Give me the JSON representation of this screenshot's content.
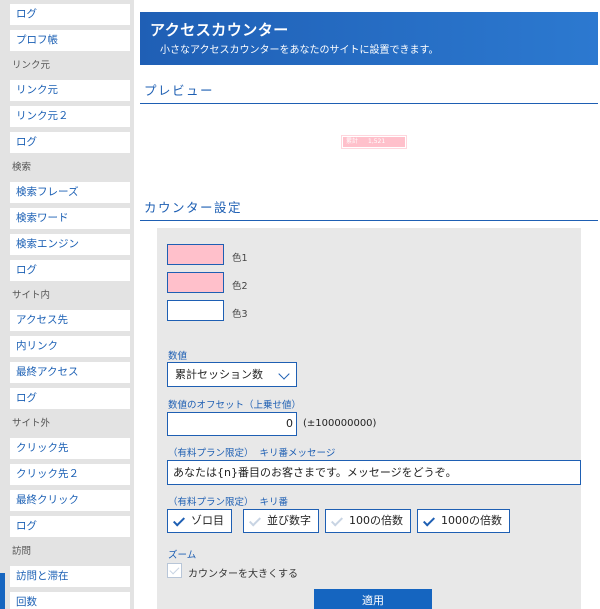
{
  "sidebar": {
    "entries": [
      {
        "kind": "item",
        "label": "ログ"
      },
      {
        "kind": "item",
        "label": "プロフ帳"
      },
      {
        "kind": "head",
        "label": "リンク元"
      },
      {
        "kind": "item",
        "label": "リンク元"
      },
      {
        "kind": "item",
        "label": "リンク元２"
      },
      {
        "kind": "item",
        "label": "ログ"
      },
      {
        "kind": "head",
        "label": "検索"
      },
      {
        "kind": "item",
        "label": "検索フレーズ"
      },
      {
        "kind": "item",
        "label": "検索ワード"
      },
      {
        "kind": "item",
        "label": "検索エンジン"
      },
      {
        "kind": "item",
        "label": "ログ"
      },
      {
        "kind": "head",
        "label": "サイト内"
      },
      {
        "kind": "item",
        "label": "アクセス先"
      },
      {
        "kind": "item",
        "label": "内リンク"
      },
      {
        "kind": "item",
        "label": "最終アクセス"
      },
      {
        "kind": "item",
        "label": "ログ"
      },
      {
        "kind": "head",
        "label": "サイト外"
      },
      {
        "kind": "item",
        "label": "クリック先"
      },
      {
        "kind": "item",
        "label": "クリック先２"
      },
      {
        "kind": "item",
        "label": "最終クリック"
      },
      {
        "kind": "item",
        "label": "ログ"
      },
      {
        "kind": "head",
        "label": "訪問"
      },
      {
        "kind": "item",
        "label": "訪問と滞在"
      },
      {
        "kind": "item",
        "label": "回数"
      }
    ]
  },
  "banner": {
    "title": "アクセスカウンター",
    "subtitle": "小さなアクセスカウンターをあなたのサイトに設置できます。"
  },
  "preview": {
    "heading": "プレビュー",
    "counter_left": "累計",
    "counter_right": "1,521"
  },
  "settings": {
    "heading": "カウンター設定",
    "colors": [
      {
        "label": "色1",
        "value": "#ffc0cb"
      },
      {
        "label": "色2",
        "value": "#ffc0cb"
      },
      {
        "label": "色3",
        "value": "#ffffff"
      }
    ],
    "value_label": "数値",
    "value_selected": "累計セッション数",
    "offset_label": "数値のオフセット（上乗せ値）",
    "offset_value": "0",
    "offset_range": "(±100000000)",
    "plan_note": "（有料プラン限定）",
    "kiriban_msg_label": "キリ番メッセージ",
    "kiriban_msg_value": "あなたは{n}番目のお客さまです。メッセージをどうぞ。",
    "kiriban_label": "キリ番",
    "kiriban_options": [
      {
        "label": "ゾロ目",
        "checked": true
      },
      {
        "label": "並び数字",
        "checked": false
      },
      {
        "label": "100の倍数",
        "checked": false
      },
      {
        "label": "1000の倍数",
        "checked": true
      }
    ],
    "zoom_label": "ズーム",
    "zoom_option": "カウンターを大きくする",
    "zoom_checked": false,
    "apply_label": "適用"
  },
  "colors": {
    "accent": "#1e5fb3",
    "sidebar_bg": "#e3e3e3"
  }
}
